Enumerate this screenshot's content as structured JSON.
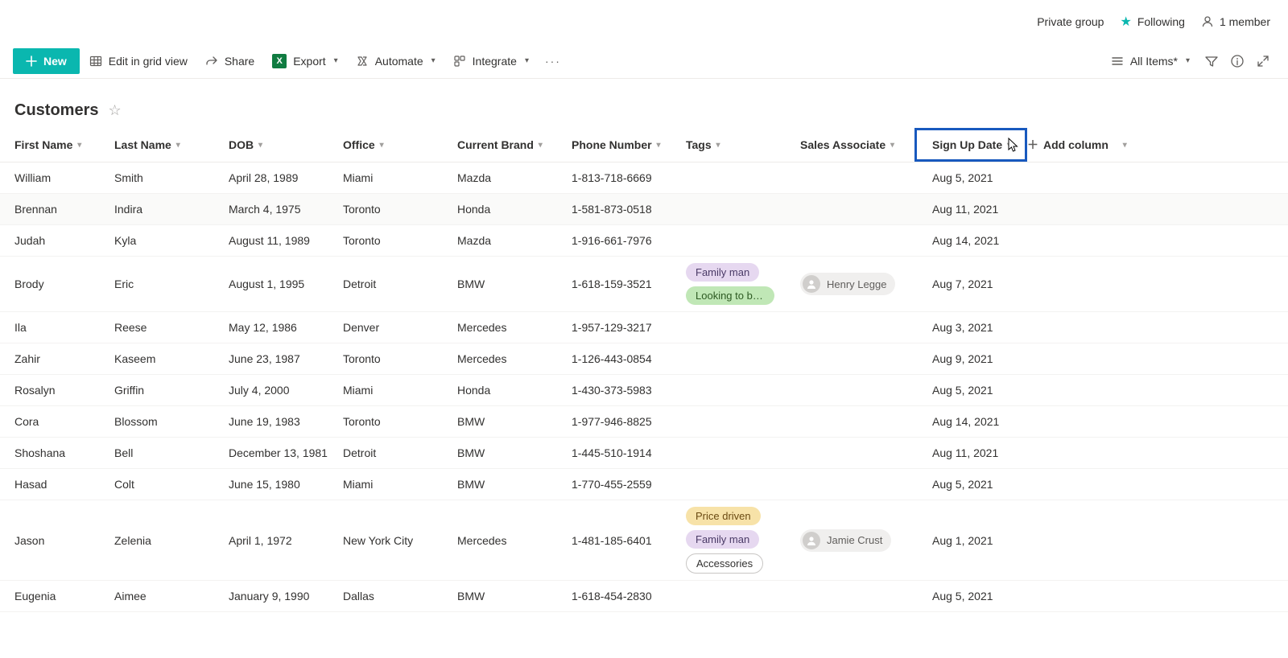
{
  "info_bar": {
    "private_group": "Private group",
    "following": "Following",
    "member_count": "1 member"
  },
  "commands": {
    "new": "New",
    "edit_grid": "Edit in grid view",
    "share": "Share",
    "export": "Export",
    "automate": "Automate",
    "integrate": "Integrate",
    "all_items": "All Items*"
  },
  "list_title": "Customers",
  "columns": {
    "first": "First Name",
    "last": "Last Name",
    "dob": "DOB",
    "office": "Office",
    "brand": "Current Brand",
    "phone": "Phone Number",
    "tags": "Tags",
    "assoc": "Sales Associate",
    "date": "Sign Up Date",
    "add": "Add column"
  },
  "tag_styles": {
    "Family man": "pill-purple",
    "Looking to buy s…": "pill-green",
    "Price driven": "pill-gold",
    "Accessories": "pill-outline"
  },
  "rows": [
    {
      "first": "William",
      "last": "Smith",
      "dob": "April 28, 1989",
      "office": "Miami",
      "brand": "Mazda",
      "phone": "1-813-718-6669",
      "tags": [],
      "assoc": null,
      "date": "Aug 5, 2021"
    },
    {
      "first": "Brennan",
      "last": "Indira",
      "dob": "March 4, 1975",
      "office": "Toronto",
      "brand": "Honda",
      "phone": "1-581-873-0518",
      "tags": [],
      "assoc": null,
      "date": "Aug 11, 2021",
      "alt": true
    },
    {
      "first": "Judah",
      "last": "Kyla",
      "dob": "August 11, 1989",
      "office": "Toronto",
      "brand": "Mazda",
      "phone": "1-916-661-7976",
      "tags": [],
      "assoc": null,
      "date": "Aug 14, 2021"
    },
    {
      "first": "Brody",
      "last": "Eric",
      "dob": "August 1, 1995",
      "office": "Detroit",
      "brand": "BMW",
      "phone": "1-618-159-3521",
      "tags": [
        "Family man",
        "Looking to buy s…"
      ],
      "assoc": "Henry Legge",
      "date": "Aug 7, 2021"
    },
    {
      "first": "Ila",
      "last": "Reese",
      "dob": "May 12, 1986",
      "office": "Denver",
      "brand": "Mercedes",
      "phone": "1-957-129-3217",
      "tags": [],
      "assoc": null,
      "date": "Aug 3, 2021"
    },
    {
      "first": "Zahir",
      "last": "Kaseem",
      "dob": "June 23, 1987",
      "office": "Toronto",
      "brand": "Mercedes",
      "phone": "1-126-443-0854",
      "tags": [],
      "assoc": null,
      "date": "Aug 9, 2021"
    },
    {
      "first": "Rosalyn",
      "last": "Griffin",
      "dob": "July 4, 2000",
      "office": "Miami",
      "brand": "Honda",
      "phone": "1-430-373-5983",
      "tags": [],
      "assoc": null,
      "date": "Aug 5, 2021"
    },
    {
      "first": "Cora",
      "last": "Blossom",
      "dob": "June 19, 1983",
      "office": "Toronto",
      "brand": "BMW",
      "phone": "1-977-946-8825",
      "tags": [],
      "assoc": null,
      "date": "Aug 14, 2021"
    },
    {
      "first": "Shoshana",
      "last": "Bell",
      "dob": "December 13, 1981",
      "office": "Detroit",
      "brand": "BMW",
      "phone": "1-445-510-1914",
      "tags": [],
      "assoc": null,
      "date": "Aug 11, 2021"
    },
    {
      "first": "Hasad",
      "last": "Colt",
      "dob": "June 15, 1980",
      "office": "Miami",
      "brand": "BMW",
      "phone": "1-770-455-2559",
      "tags": [],
      "assoc": null,
      "date": "Aug 5, 2021"
    },
    {
      "first": "Jason",
      "last": "Zelenia",
      "dob": "April 1, 1972",
      "office": "New York City",
      "brand": "Mercedes",
      "phone": "1-481-185-6401",
      "tags": [
        "Price driven",
        "Family man",
        "Accessories"
      ],
      "assoc": "Jamie Crust",
      "date": "Aug 1, 2021"
    },
    {
      "first": "Eugenia",
      "last": "Aimee",
      "dob": "January 9, 1990",
      "office": "Dallas",
      "brand": "BMW",
      "phone": "1-618-454-2830",
      "tags": [],
      "assoc": null,
      "date": "Aug 5, 2021"
    }
  ]
}
